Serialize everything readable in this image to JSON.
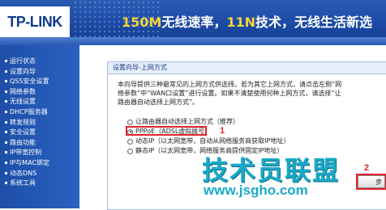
{
  "header": {
    "logo": "TP-LINK",
    "slogan_highlight_1": "150M",
    "slogan_part_1": "无线速率，",
    "slogan_highlight_2": "11N",
    "slogan_part_2": "技术，无线生活新选"
  },
  "sidebar": {
    "items": [
      {
        "label": "运行状态"
      },
      {
        "label": "设置向导"
      },
      {
        "label": "QSS安全设置"
      },
      {
        "label": "网络参数"
      },
      {
        "label": "无线设置"
      },
      {
        "label": "DHCP服务器"
      },
      {
        "label": "转发规则"
      },
      {
        "label": "安全设置"
      },
      {
        "label": "路由功能"
      },
      {
        "label": "IP带宽控制"
      },
      {
        "label": "IP与MAC绑定"
      },
      {
        "label": "动态DNS"
      },
      {
        "label": "系统工具"
      }
    ]
  },
  "wizard": {
    "title": "设置向导-上网方式",
    "desc_line_1": "本向导提供三种最常见的上网方式供选择。若为其它上网方式，请点击左侧“网",
    "desc_line_2": "络参数”中“WAN口设置”进行设置。如果不清楚使用何种上网方式，请选择“让",
    "desc_line_3": "路由器自动选择上网方式”。",
    "options": [
      {
        "label": "让路由器自动选择上网方式（推荐）",
        "selected": false
      },
      {
        "label": "PPPoE（ADSL虚拟拨号）",
        "selected": true
      },
      {
        "label": "动态IP（以太网宽带，自动从网络服务商获取IP地址）",
        "selected": false
      },
      {
        "label": "静态IP（以太网宽带，网络服务商提供固定IP地址）",
        "selected": false
      }
    ],
    "next_label": "步",
    "annotation_1": "1",
    "annotation_2": "2"
  },
  "watermark": {
    "text": "技术员联盟",
    "url": "www.jsgho.com"
  },
  "colors": {
    "header_blue": "#1c4aa3",
    "highlight_yellow": "#f6d33a",
    "annotation_red": "#e0242b",
    "watermark_cyan": "#1aa9c9"
  }
}
